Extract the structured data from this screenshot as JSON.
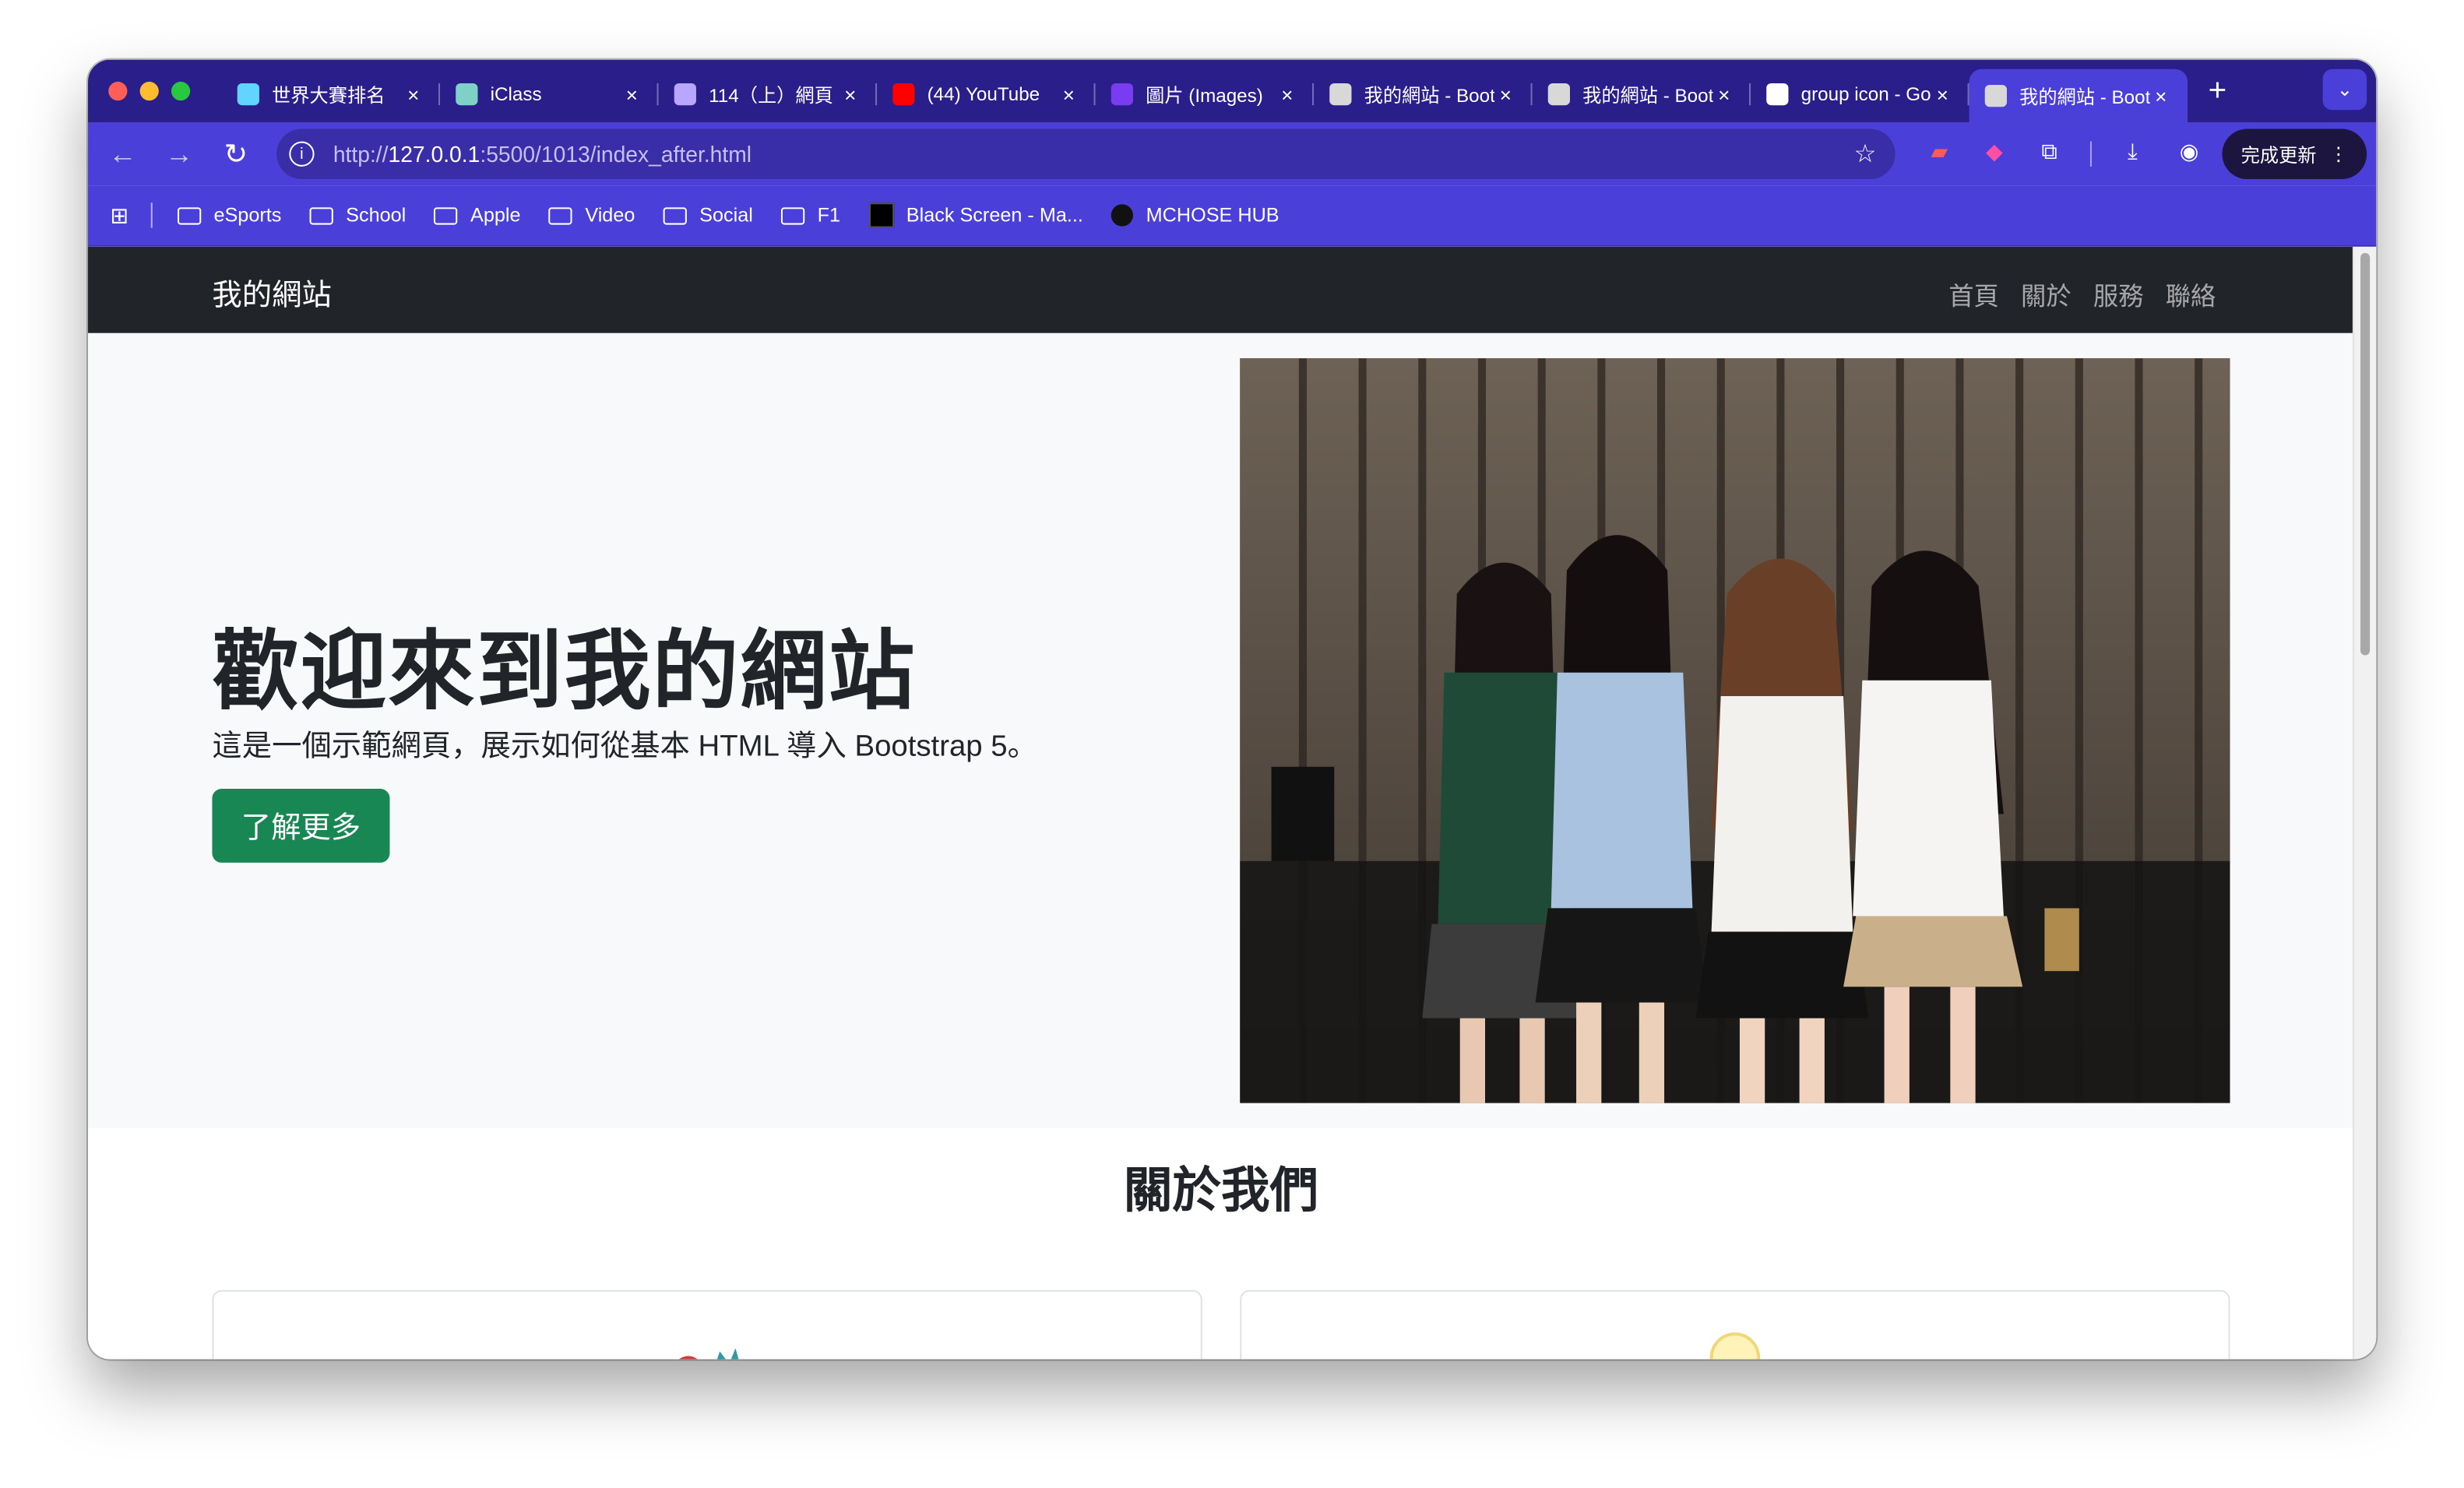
{
  "browser": {
    "tabs": [
      {
        "title": "世界大賽排名",
        "favicon": "link-icon",
        "color": "#61d4ff"
      },
      {
        "title": "iClass",
        "favicon": "pen-icon",
        "color": "#7fd1c8"
      },
      {
        "title": "114（上）網頁",
        "favicon": "layers-icon",
        "color": "#b9a6ff"
      },
      {
        "title": "(44) YouTube",
        "favicon": "youtube-icon",
        "color": "#ff0000"
      },
      {
        "title": "圖片 (Images)",
        "favicon": "bootstrap-icon",
        "color": "#7a3cf0"
      },
      {
        "title": "我的網站 - Bootstrap",
        "favicon": "globe-icon",
        "color": "#d8d8d8"
      },
      {
        "title": "我的網站 - Bootstrap",
        "favicon": "globe-icon",
        "color": "#d8d8d8"
      },
      {
        "title": "group icon - Google",
        "favicon": "google-icon",
        "color": "#ffffff"
      },
      {
        "title": "我的網站 - Bootstrap",
        "favicon": "globe-icon",
        "color": "#d8d8d8",
        "active": true
      }
    ],
    "url_prefix": "http://",
    "url_host": "127.0.0.1",
    "url_rest": ":5500/1013/index_after.html",
    "update_button": "完成更新",
    "bookmarks": [
      {
        "label": "eSports",
        "type": "folder"
      },
      {
        "label": "School",
        "type": "folder"
      },
      {
        "label": "Apple",
        "type": "folder"
      },
      {
        "label": "Video",
        "type": "folder"
      },
      {
        "label": "Social",
        "type": "folder"
      },
      {
        "label": "F1",
        "type": "folder"
      },
      {
        "label": "Black Screen - Ma...",
        "type": "page"
      },
      {
        "label": "MCHOSE HUB",
        "type": "page"
      }
    ]
  },
  "site": {
    "brand": "我的網站",
    "nav": [
      "首頁",
      "關於",
      "服務",
      "聯絡"
    ],
    "hero": {
      "title": "歡迎來到我的網站",
      "subtitle": "這是一個示範網頁，展示如何從基本 HTML 導入 Bootstrap 5。",
      "button": "了解更多"
    },
    "about_heading": "關於我們"
  },
  "colors": {
    "tab_strip": "#2a1e8a",
    "toolbar": "#4a3fd8",
    "navbar": "#212529",
    "hero_bg": "#f8f9fa",
    "cta": "#198754"
  }
}
